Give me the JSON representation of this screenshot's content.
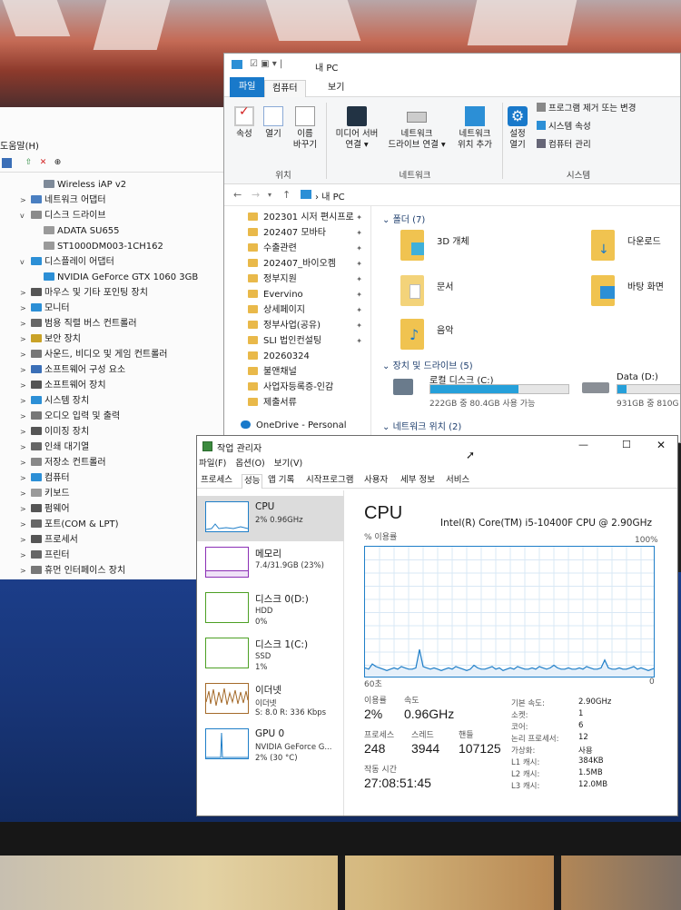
{
  "device_manager": {
    "menu_partial": "도움말(H)",
    "toolbar_icons": [
      "monitor-icon",
      "driver-update-icon",
      "remove-icon",
      "download-icon"
    ],
    "tree": [
      {
        "label": "Wireless iAP v2",
        "level": 2,
        "arrow": ""
      },
      {
        "label": "네트워크 어댑터",
        "level": 1,
        "arrow": ">"
      },
      {
        "label": "디스크 드라이브",
        "level": 1,
        "arrow": "v"
      },
      {
        "label": "ADATA SU655",
        "level": 2,
        "arrow": ""
      },
      {
        "label": "ST1000DM003-1CH162",
        "level": 2,
        "arrow": ""
      },
      {
        "label": "디스플레이 어댑터",
        "level": 1,
        "arrow": "v"
      },
      {
        "label": "NVIDIA GeForce GTX 1060 3GB",
        "level": 2,
        "arrow": ""
      },
      {
        "label": "마우스 및 기타 포인팅 장치",
        "level": 1,
        "arrow": ">"
      },
      {
        "label": "모니터",
        "level": 1,
        "arrow": ">"
      },
      {
        "label": "범용 직렬 버스 컨트롤러",
        "level": 1,
        "arrow": ">"
      },
      {
        "label": "보안 장치",
        "level": 1,
        "arrow": ">"
      },
      {
        "label": "사운드, 비디오 및 게임 컨트롤러",
        "level": 1,
        "arrow": ">"
      },
      {
        "label": "소프트웨어 구성 요소",
        "level": 1,
        "arrow": ">"
      },
      {
        "label": "소프트웨어 장치",
        "level": 1,
        "arrow": ">"
      },
      {
        "label": "시스템 장치",
        "level": 1,
        "arrow": ">"
      },
      {
        "label": "오디오 입력 및 출력",
        "level": 1,
        "arrow": ">"
      },
      {
        "label": "이미징 장치",
        "level": 1,
        "arrow": ">"
      },
      {
        "label": "인쇄 대기열",
        "level": 1,
        "arrow": ">"
      },
      {
        "label": "저장소 컨트롤러",
        "level": 1,
        "arrow": ">"
      },
      {
        "label": "컴퓨터",
        "level": 1,
        "arrow": ">"
      },
      {
        "label": "키보드",
        "level": 1,
        "arrow": ">"
      },
      {
        "label": "펌웨어",
        "level": 1,
        "arrow": ">"
      },
      {
        "label": "포트(COM & LPT)",
        "level": 1,
        "arrow": ">"
      },
      {
        "label": "프로세서",
        "level": 1,
        "arrow": ">"
      },
      {
        "label": "프린터",
        "level": 1,
        "arrow": ">"
      },
      {
        "label": "휴먼 인터페이스 장치",
        "level": 1,
        "arrow": ">"
      }
    ]
  },
  "explorer": {
    "title": "내 PC",
    "tabs": {
      "file": "파일",
      "computer": "컴퓨터",
      "view": "보기"
    },
    "ribbon": {
      "properties": "속성",
      "open": "열기",
      "rename_1": "이름",
      "rename_2": "바꾸기",
      "location_group": "위치",
      "media_server_1": "미디어 서버",
      "media_server_2": "연결 ▾",
      "net_drive_1": "네트워크",
      "net_drive_2": "드라이브 연결 ▾",
      "net_loc_1": "네트워크",
      "net_loc_2": "위치 추가",
      "network_group": "네트워크",
      "settings_1": "설정",
      "settings_2": "열기",
      "uninstall": "프로그램 제거 또는 변경",
      "sys_props": "시스템 속성",
      "manage": "컴퓨터 관리",
      "system_group": "시스템"
    },
    "address": "내 PC",
    "quick_access": [
      "202301 시저 편시프로",
      "202407 모바타",
      "수출관련",
      "202407_바이오켐",
      "정부지원",
      "Evervino",
      "상세페이지",
      "정부사업(공유)",
      "SLI 법인컨설팅",
      "20260324",
      "불앤채널",
      "사업자등록증-인감",
      "제출서류"
    ],
    "onedrive": "OneDrive - Personal",
    "folders_header": "폴더 (7)",
    "folders": [
      "3D 개체",
      "다운로드",
      "문서",
      "바탕 화면",
      "음악"
    ],
    "drives_header": "장치 및 드라이브 (5)",
    "drive_c": {
      "name": "로컬 디스크 (C:)",
      "info": "222GB 중 80.4GB 사용 가능",
      "used_fraction": 0.64
    },
    "drive_d": {
      "name": "Data (D:)",
      "info": "931GB 중 810G",
      "used_fraction": 0.13
    },
    "network_header": "네트워크 위치 (2)"
  },
  "task_manager": {
    "title": "작업 관리자",
    "menu": [
      "파일(F)",
      "옵션(O)",
      "보기(V)"
    ],
    "tabs": [
      "프로세스",
      "성능",
      "앱 기록",
      "시작프로그램",
      "사용자",
      "세부 정보",
      "서비스"
    ],
    "resources": [
      {
        "name": "CPU",
        "sub1": "2% 0.96GHz",
        "sub2": "",
        "sub3": "",
        "color": "#1e7ec8"
      },
      {
        "name": "메모리",
        "sub1": "7.4/31.9GB (23%)",
        "sub2": "",
        "sub3": "",
        "color": "#8b2fb5"
      },
      {
        "name": "디스크 0(D:)",
        "sub1": "HDD",
        "sub2": "0%",
        "sub3": "",
        "color": "#4da024"
      },
      {
        "name": "디스크 1(C:)",
        "sub1": "SSD",
        "sub2": "1%",
        "sub3": "",
        "color": "#4da024"
      },
      {
        "name": "이더넷",
        "sub1": "이더넷",
        "sub2": "S: 8.0 R: 336 Kbps",
        "sub3": "",
        "color": "#a46a2a"
      },
      {
        "name": "GPU 0",
        "sub1": "NVIDIA GeForce G...",
        "sub2": "2% (30 °C)",
        "sub3": "",
        "color": "#1e7ec8"
      }
    ],
    "cpu": {
      "title": "CPU",
      "model": "Intel(R) Core(TM) i5-10400F CPU @ 2.90GHz",
      "graph_label": "% 이용률",
      "graph_max": "100%",
      "graph_time": "60초",
      "graph_zero": "0",
      "utilization_label": "이용률",
      "utilization": "2%",
      "speed_label": "속도",
      "speed": "0.96GHz",
      "processes_label": "프로세스",
      "processes": "248",
      "threads_label": "스레드",
      "threads": "3944",
      "handles_label": "핸들",
      "handles": "107125",
      "uptime_label": "작동 시간",
      "uptime": "27:08:51:45",
      "specs": [
        {
          "k": "기본 속도:",
          "v": "2.90GHz"
        },
        {
          "k": "소켓:",
          "v": "1"
        },
        {
          "k": "코어:",
          "v": "6"
        },
        {
          "k": "논리 프로세서:",
          "v": "12"
        },
        {
          "k": "가상화:",
          "v": "사용"
        },
        {
          "k": "L1 캐시:",
          "v": "384KB"
        },
        {
          "k": "L2 캐시:",
          "v": "1.5MB"
        },
        {
          "k": "L3 캐시:",
          "v": "12.0MB"
        }
      ],
      "history": [
        8,
        7,
        11,
        9,
        8,
        7,
        6,
        7,
        8,
        7,
        9,
        8,
        7,
        7,
        8,
        22,
        9,
        8,
        7,
        8,
        7,
        6,
        7,
        8,
        7,
        9,
        8,
        7,
        6,
        7,
        10,
        8,
        7,
        7,
        8,
        9,
        7,
        8,
        6,
        7,
        8,
        7,
        9,
        8,
        7,
        7,
        8,
        7,
        9,
        8,
        7,
        8,
        10,
        8,
        7,
        7,
        8,
        7,
        7,
        8,
        7,
        9,
        8,
        7,
        7,
        8,
        14,
        8,
        7,
        7,
        8,
        7,
        7,
        8,
        9,
        7,
        8,
        7,
        6,
        7,
        8
      ]
    }
  },
  "colors": {
    "cpu_line": "#1e7ec8",
    "cpu_fill": "#e6f0fa",
    "ribbon_file_tab": "#1979ca",
    "drive_fill": "#26a0da"
  }
}
